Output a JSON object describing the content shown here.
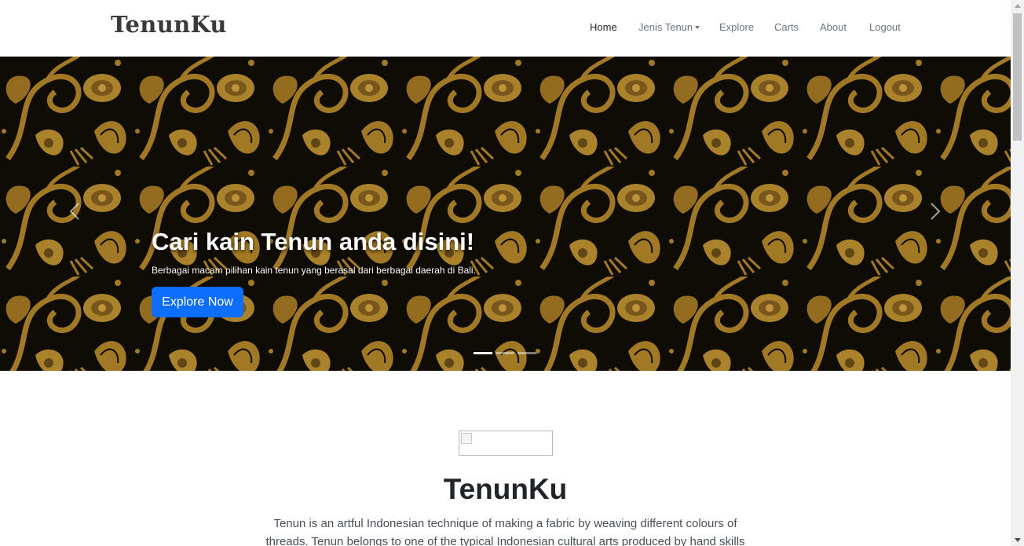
{
  "brand": "TenunKu",
  "nav": {
    "home": "Home",
    "jenis": "Jenis Tenun",
    "explore": "Explore",
    "carts": "Carts",
    "about": "About",
    "logout": "Logout"
  },
  "hero": {
    "title": "Cari kain Tenun anda disini!",
    "subtitle": "Berbagai macam pilihan kain tenun yang berasal dari berbagai daerah di Bali.",
    "button": "Explore Now",
    "slides": 3,
    "active_slide": 1,
    "colors": {
      "pattern": "#b8892a",
      "background": "#120d06"
    }
  },
  "content": {
    "title": "TenunKu",
    "description": "Tenun is an artful Indonesian technique of making a fabric by weaving different colours of threads. Tenun belongs to one of the typical Indonesian cultural arts produced by hand skills"
  },
  "colors": {
    "primary": "#0d6efd",
    "nav_text": "#6c757d",
    "nav_active": "#212529"
  }
}
